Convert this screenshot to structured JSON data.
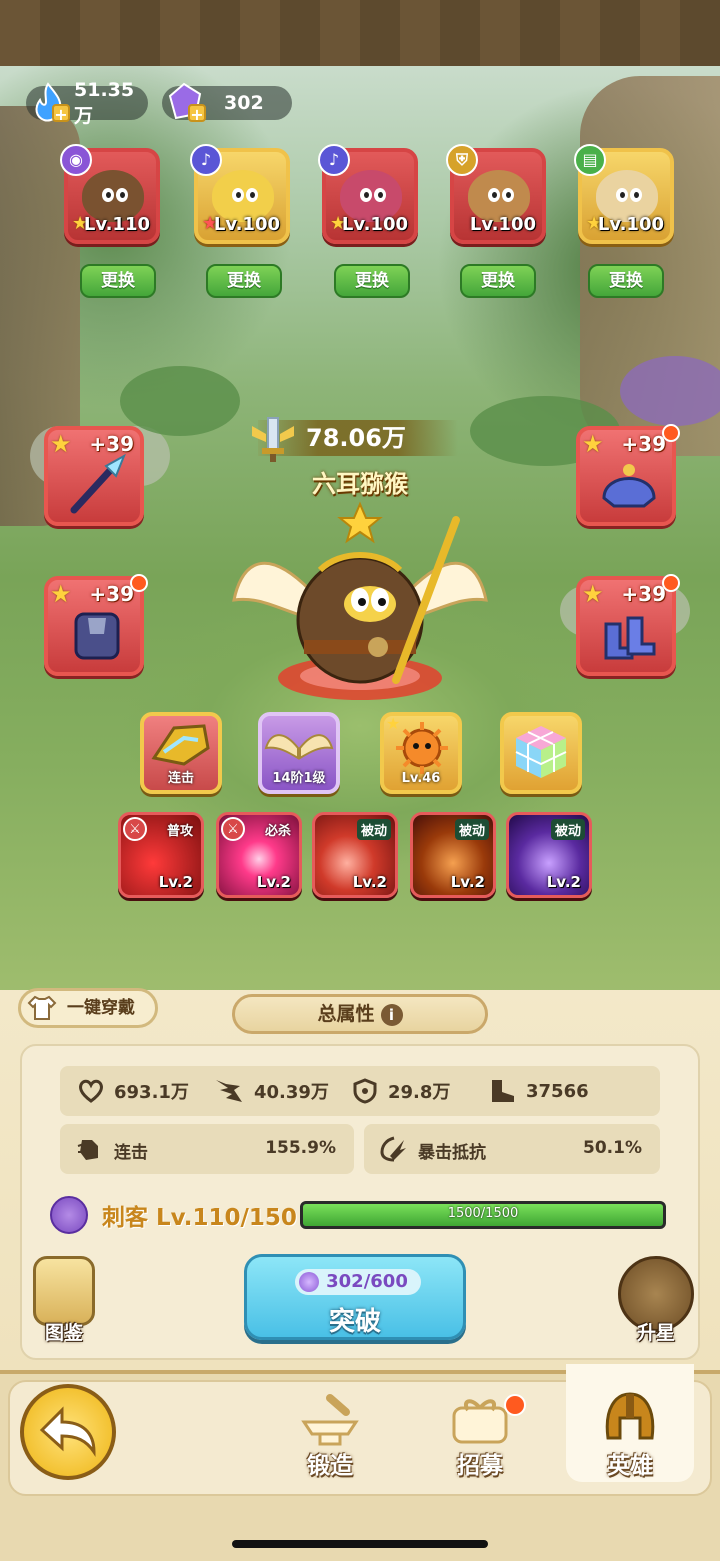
{
  "currency": {
    "energy": "51.35万",
    "gems": "302"
  },
  "team": [
    {
      "level": "Lv.110",
      "class_icon": "assassin-hood-icon",
      "swap_label": "更换"
    },
    {
      "level": "Lv.100",
      "class_icon": "mage-staff-icon",
      "swap_label": "更换"
    },
    {
      "level": "Lv.100",
      "class_icon": "mage-staff-icon",
      "swap_label": "更换"
    },
    {
      "level": "Lv.100",
      "class_icon": "tank-shield-icon",
      "swap_label": "更换"
    },
    {
      "level": "Lv.100",
      "class_icon": "support-book-icon",
      "swap_label": "更换"
    }
  ],
  "hero": {
    "power": "78.06万",
    "name": "六耳猕猴"
  },
  "equipment": {
    "weapon": "+39",
    "helmet": "+39",
    "armor": "+39",
    "boots": "+39"
  },
  "slots": {
    "combo_label": "连击",
    "wings_label": "14阶1级",
    "pet_label": "Lv.46"
  },
  "skills": [
    {
      "tag": "普攻",
      "level": "Lv.2"
    },
    {
      "tag": "必杀",
      "level": "Lv.2"
    },
    {
      "tag": "被动",
      "level": "Lv.2"
    },
    {
      "tag": "被动",
      "level": "Lv.2"
    },
    {
      "tag": "被动",
      "level": "Lv.2"
    }
  ],
  "panel": {
    "wear_all": "一键穿戴",
    "total_attr": "总属性",
    "info_icon": "i",
    "hp": "693.1万",
    "attack": "40.39万",
    "defense": "29.8万",
    "speed": "37566",
    "combo_label": "连击",
    "combo_value": "155.9%",
    "crit_resist_label": "暴击抵抗",
    "crit_resist_value": "50.1%",
    "class_line": "刺客 Lv.110/150",
    "xp_text": "1500/1500",
    "xp_fraction": 1.0,
    "codex": "图鉴",
    "star_up": "升星",
    "breakthrough_cost": "302/600",
    "breakthrough": "突破"
  },
  "nav": {
    "forge": "锻造",
    "recruit": "招募",
    "hero": "英雄"
  },
  "colors": {
    "accent_red": "#d64545",
    "accent_gold": "#f0c24a",
    "breakthrough_blue": "#49c0e6",
    "swap_green": "#44a63a"
  }
}
